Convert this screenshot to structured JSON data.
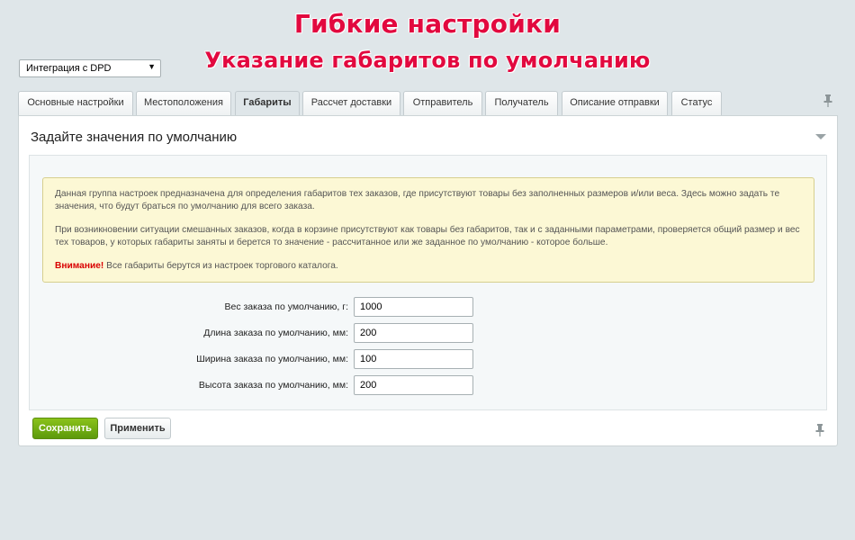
{
  "promo": {
    "line1": "Гибкие настройки",
    "line2": "Указание габаритов по умолчанию"
  },
  "module_select": {
    "value": "Интеграция с DPD"
  },
  "tabs": [
    {
      "label": "Основные настройки",
      "active": false
    },
    {
      "label": "Местоположения",
      "active": false
    },
    {
      "label": "Габариты",
      "active": true
    },
    {
      "label": "Рассчет доставки",
      "active": false
    },
    {
      "label": "Отправитель",
      "active": false
    },
    {
      "label": "Получатель",
      "active": false
    },
    {
      "label": "Описание отправки",
      "active": false
    },
    {
      "label": "Статус",
      "active": false
    }
  ],
  "section": {
    "title": "Задайте значения по умолчанию"
  },
  "note": {
    "p1": "Данная группа настроек предназначена для определения габаритов тех заказов, где присутствуют товары без заполненных размеров и/или веса. Здесь можно задать те значения, что будут браться по умолчанию для всего заказа.",
    "p2": "При возникновении ситуации смешанных заказов, когда в корзине присутствуют как товары без габаритов, так и с заданными параметрами, проверяется общий размер и вес тех товаров, у которых габариты заняты и берется то значение - рассчитанное или же заданное по умолчанию - которое больше.",
    "warning_label": "Внимание!",
    "warning_text": " Все габариты берутся из настроек торгового каталога."
  },
  "fields": [
    {
      "label": "Вес заказа по умолчанию, г:",
      "value": "1000"
    },
    {
      "label": "Длина заказа по умолчанию, мм:",
      "value": "200"
    },
    {
      "label": "Ширина заказа по умолчанию, мм:",
      "value": "100"
    },
    {
      "label": "Высота заказа по умолчанию, мм:",
      "value": "200"
    }
  ],
  "buttons": {
    "save": "Сохранить",
    "apply": "Применить"
  },
  "colors": {
    "accent_title": "#e2093f",
    "save_button": "#6aa90f",
    "warning": "#d90000"
  },
  "icons": {
    "pin": "pin-icon",
    "collapse": "triangle-down-icon",
    "dropdown": "caret-down-icon"
  }
}
